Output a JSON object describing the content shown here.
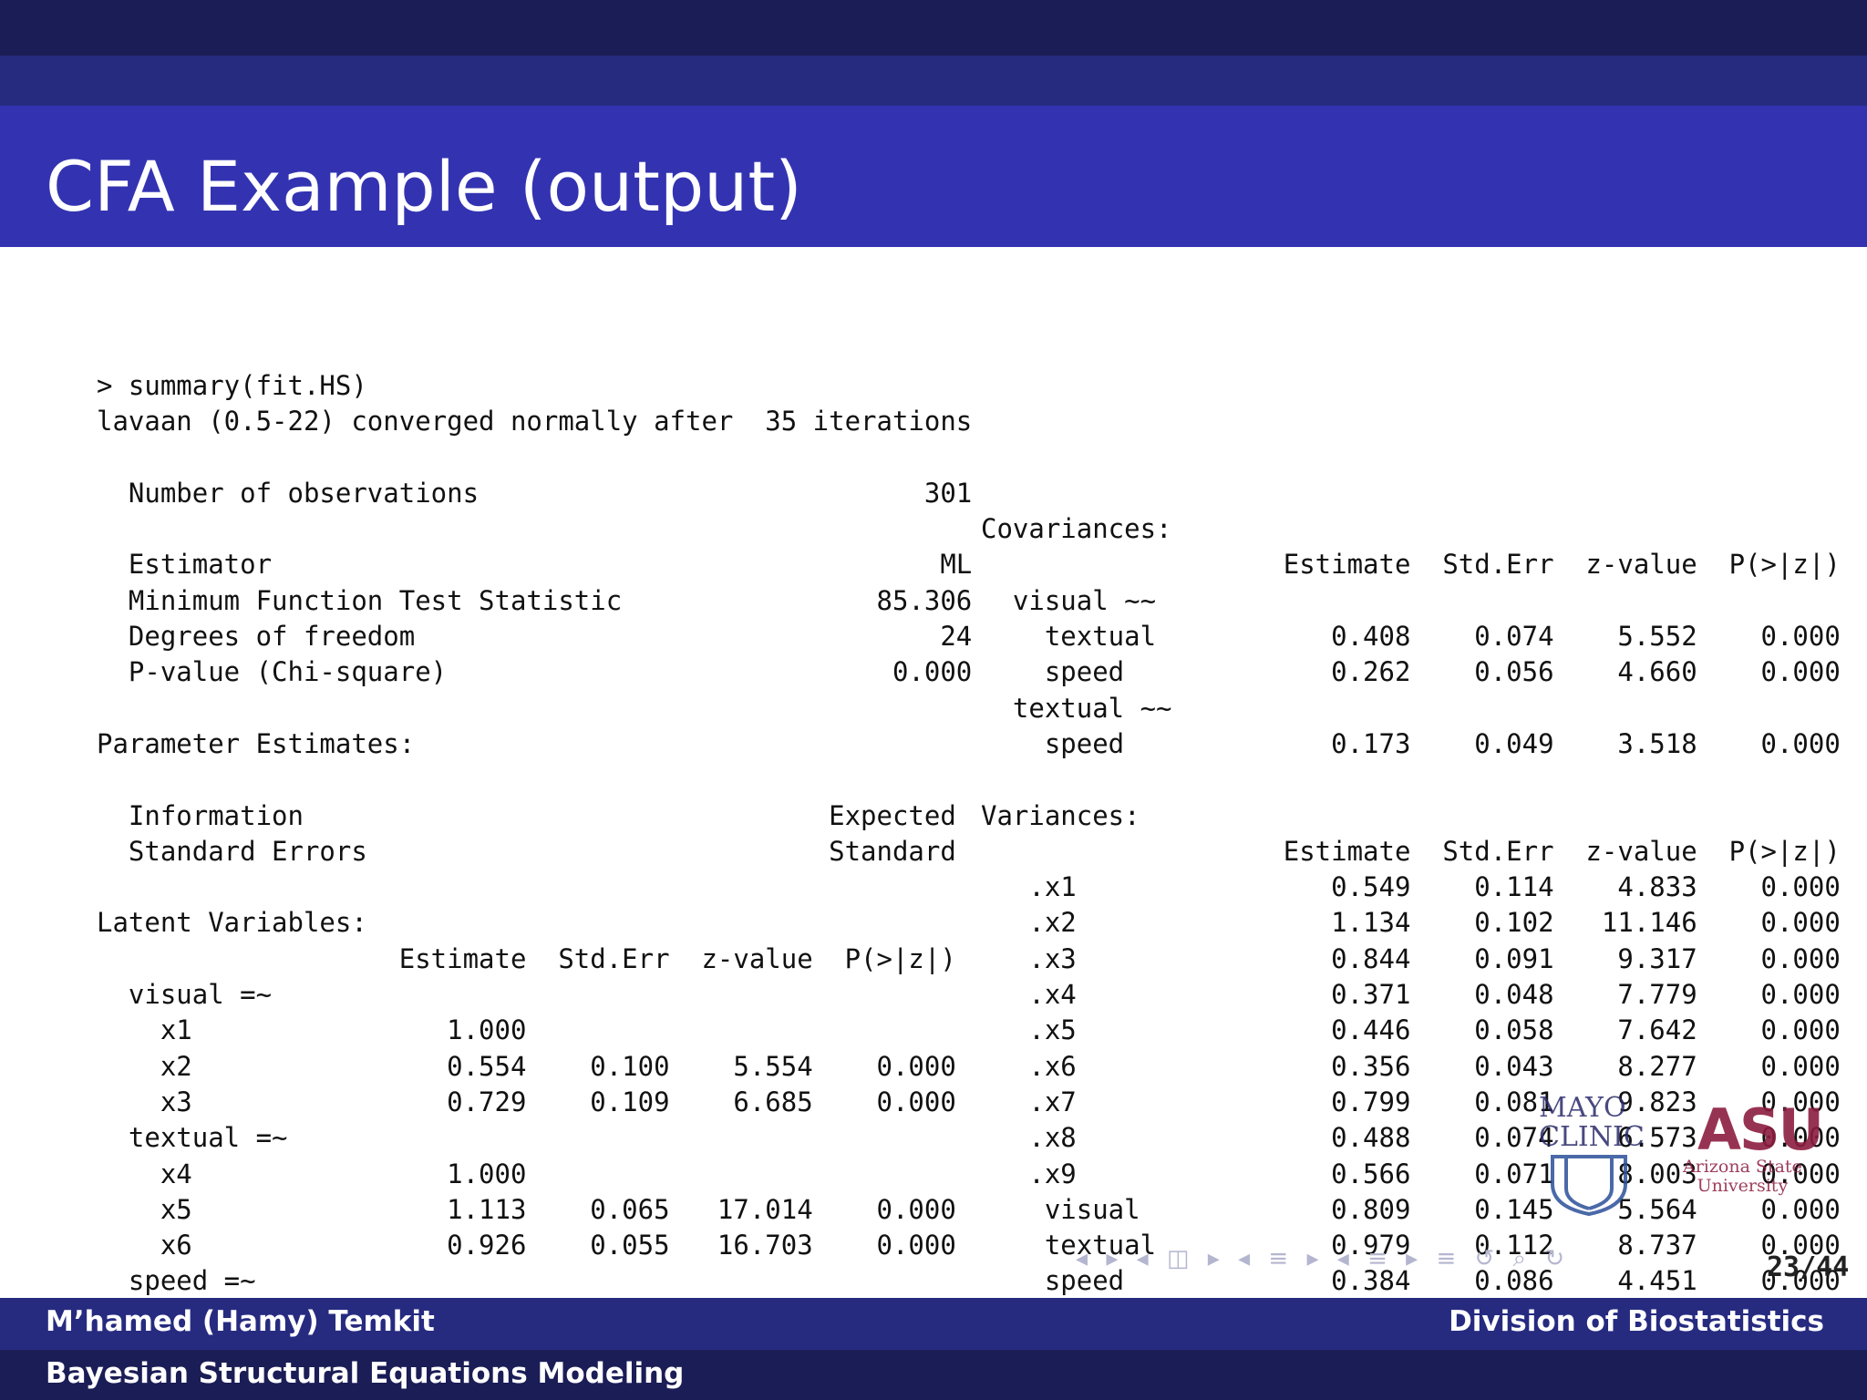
{
  "slide": {
    "title": "CFA Example (output)",
    "footer_left_top": "M’hamed (Hamy) Temkit",
    "footer_right_top": "Division of Biostatistics",
    "footer_left_bottom": "Bayesian Structural Equations Modeling",
    "page_number": "23/44"
  },
  "logos": {
    "mayo_line1": "MAYO",
    "mayo_line2": "CLINIC",
    "asu_mark": "ASU",
    "asu_line1": "Arizona State",
    "asu_line2": "University"
  },
  "left_output": [
    "> summary(fit.HS)",
    "lavaan (0.5-22) converged normally after  35 iterations",
    "",
    "  Number of observations                            301",
    "",
    "  Estimator                                          ML",
    "  Minimum Function Test Statistic                85.306",
    "  Degrees of freedom                                 24",
    "  P-value (Chi-square)                            0.000",
    "",
    "Parameter Estimates:",
    "",
    "  Information                                 Expected",
    "  Standard Errors                             Standard",
    "",
    "Latent Variables:",
    "                   Estimate  Std.Err  z-value  P(>|z|)",
    "  visual =~",
    "    x1                1.000",
    "    x2                0.554    0.100    5.554    0.000",
    "    x3                0.729    0.109    6.685    0.000",
    "  textual =~",
    "    x4                1.000",
    "    x5                1.113    0.065   17.014    0.000",
    "    x6                0.926    0.055   16.703    0.000",
    "  speed =~"
  ],
  "right_output": [
    "",
    "",
    "",
    "",
    "Covariances:",
    "                   Estimate  Std.Err  z-value  P(>|z|)",
    "  visual ~~",
    "    textual           0.408    0.074    5.552    0.000",
    "    speed             0.262    0.056    4.660    0.000",
    "  textual ~~",
    "    speed             0.173    0.049    3.518    0.000",
    "",
    "Variances:",
    "                   Estimate  Std.Err  z-value  P(>|z|)",
    "   .x1                0.549    0.114    4.833    0.000",
    "   .x2                1.134    0.102   11.146    0.000",
    "   .x3                0.844    0.091    9.317    0.000",
    "   .x4                0.371    0.048    7.779    0.000",
    "   .x5                0.446    0.058    7.642    0.000",
    "   .x6                0.356    0.043    8.277    0.000",
    "   .x7                0.799    0.081    9.823    0.000",
    "   .x8                0.488    0.074    6.573    0.000",
    "   .x9                0.566    0.071    8.003    0.000",
    "    visual            0.809    0.145    5.564    0.000",
    "    textual           0.979    0.112    8.737    0.000",
    "    speed             0.384    0.086    4.451    0.000"
  ],
  "nav_symbols": "◂ ▸ ◂ ◫ ▸ ◂ ≡ ▸ ◂ ≡ ▸ ≡ ↺ ⌕ ↻"
}
